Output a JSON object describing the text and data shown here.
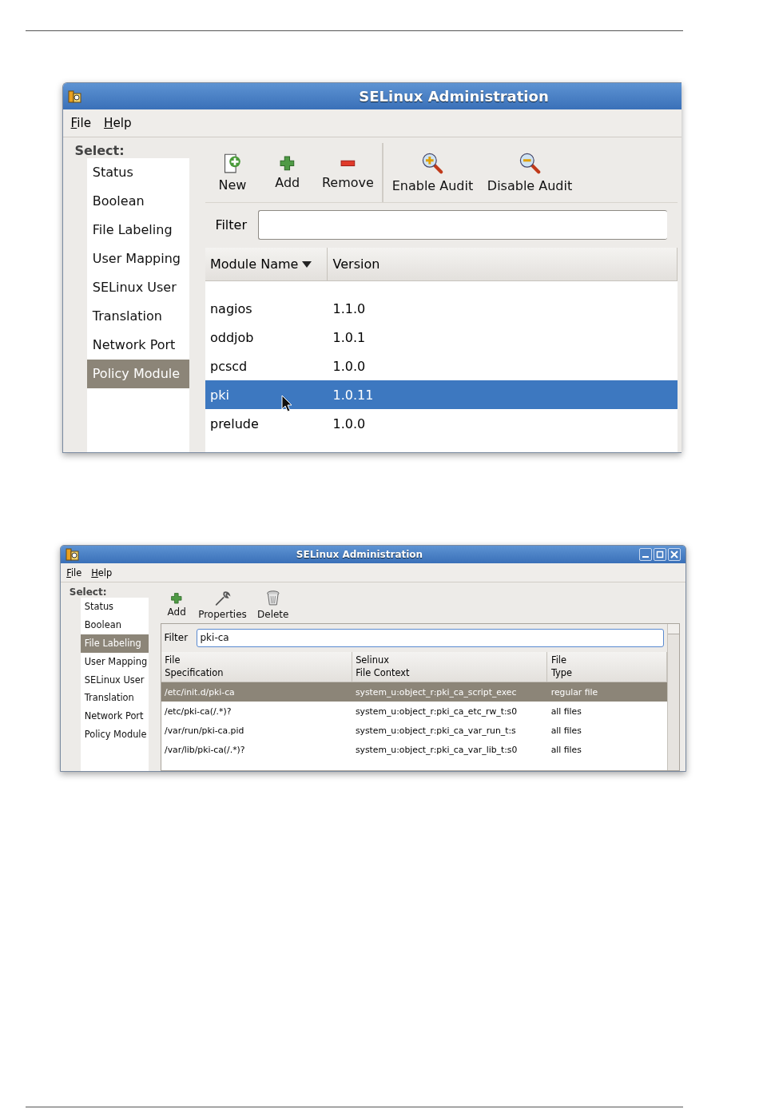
{
  "windows": [
    {
      "kind": "zoomed",
      "title": "SELinux Administration",
      "menu": [
        {
          "label": "File"
        },
        {
          "label": "Help"
        }
      ],
      "sidebar": {
        "heading": "Select:",
        "items": [
          {
            "label": "Status",
            "selected": false
          },
          {
            "label": "Boolean",
            "selected": false
          },
          {
            "label": "File Labeling",
            "selected": false
          },
          {
            "label": "User Mapping",
            "selected": false
          },
          {
            "label": "SELinux User",
            "selected": false
          },
          {
            "label": "Translation",
            "selected": false
          },
          {
            "label": "Network Port",
            "selected": false
          },
          {
            "label": "Policy Module",
            "selected": true
          }
        ]
      },
      "toolbar": {
        "groups": [
          {
            "buttons": [
              {
                "label": "New",
                "kind": "new"
              },
              {
                "label": "Add",
                "kind": "add"
              },
              {
                "label": "Remove",
                "kind": "remove"
              }
            ]
          },
          {
            "buttons": [
              {
                "label": "Enable Audit",
                "kind": "enable"
              },
              {
                "label": "Disable Audit",
                "kind": "disable"
              }
            ]
          }
        ]
      },
      "filter": {
        "label": "Filter"
      },
      "table": {
        "columns": [
          {
            "label": "Module Name",
            "sorted": true
          },
          {
            "label": "Version",
            "sorted": false
          }
        ],
        "rows": [
          {
            "cells": [
              "nagios",
              "1.1.0"
            ],
            "selected": false
          },
          {
            "cells": [
              "oddjob",
              "1.0.1"
            ],
            "selected": false
          },
          {
            "cells": [
              "pcscd",
              "1.0.0"
            ],
            "selected": false
          },
          {
            "cells": [
              "pki",
              "1.0.11"
            ],
            "selected": true
          },
          {
            "cells": [
              "prelude",
              "1.0.0"
            ],
            "selected": false
          }
        ]
      }
    },
    {
      "kind": "full",
      "title": "SELinux Administration",
      "menu": [
        {
          "label": "File"
        },
        {
          "label": "Help"
        }
      ],
      "sidebar": {
        "heading": "Select:",
        "items": [
          {
            "label": "Status",
            "selected": false
          },
          {
            "label": "Boolean",
            "selected": false
          },
          {
            "label": "File Labeling",
            "selected": true
          },
          {
            "label": "User Mapping",
            "selected": false
          },
          {
            "label": "SELinux User",
            "selected": false
          },
          {
            "label": "Translation",
            "selected": false
          },
          {
            "label": "Network Port",
            "selected": false
          },
          {
            "label": "Policy Module",
            "selected": false
          }
        ]
      },
      "toolbar": {
        "groups": [
          {
            "buttons": [
              {
                "label": "Add",
                "kind": "add"
              },
              {
                "label": "Properties",
                "kind": "properties"
              },
              {
                "label": "Delete",
                "kind": "delete"
              }
            ]
          }
        ]
      },
      "filter": {
        "label": "Filter",
        "value": "pki-ca"
      },
      "table": {
        "columns": [
          {
            "label": "File\nSpecification",
            "sorted": false
          },
          {
            "label": "Selinux\nFile Context",
            "sorted": false
          },
          {
            "label": "File\nType",
            "sorted": false
          }
        ],
        "rows": [
          {
            "cells": [
              "/etc/init.d/pki-ca",
              "system_u:object_r:pki_ca_script_exec",
              "regular file"
            ],
            "selected": true
          },
          {
            "cells": [
              "/etc/pki-ca(/.*)?",
              "system_u:object_r:pki_ca_etc_rw_t:s0",
              "all files"
            ],
            "selected": false
          },
          {
            "cells": [
              "/var/run/pki-ca.pid",
              "system_u:object_r:pki_ca_var_run_t:s",
              "all files"
            ],
            "selected": false
          },
          {
            "cells": [
              "/var/lib/pki-ca(/.*)?",
              "system_u:object_r:pki_ca_var_lib_t:s0",
              "all files"
            ],
            "selected": false
          }
        ]
      }
    }
  ]
}
